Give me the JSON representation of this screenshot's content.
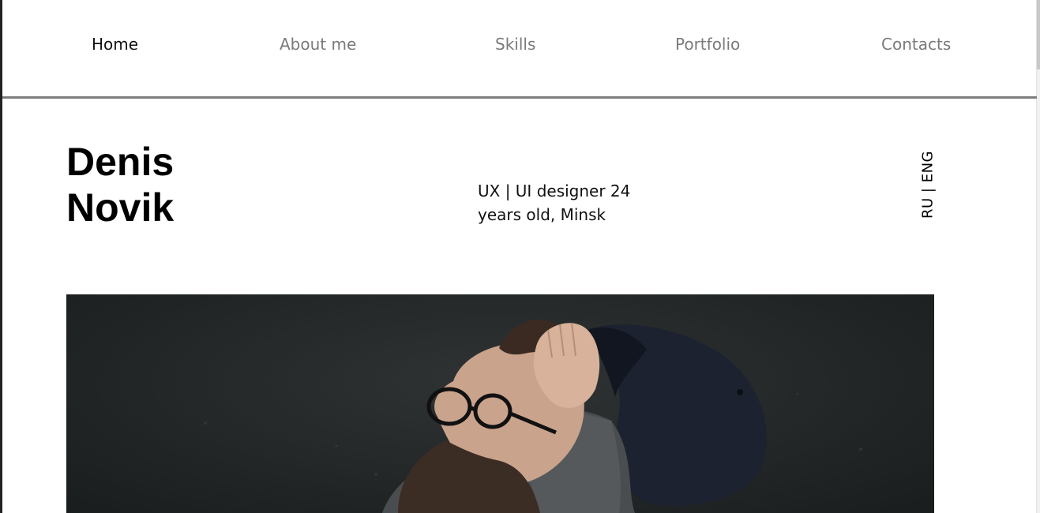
{
  "nav": {
    "items": [
      {
        "label": "Home",
        "active": true
      },
      {
        "label": "About me",
        "active": false
      },
      {
        "label": "Skills",
        "active": false
      },
      {
        "label": "Portfolio",
        "active": false
      },
      {
        "label": "Contacts",
        "active": false
      }
    ]
  },
  "hero": {
    "name_first": "Denis",
    "name_last": "Novik",
    "tagline_line1": "UX | UI designer 24",
    "tagline_line2": "years old, Minsk",
    "language_switch": "RU | ENG"
  },
  "photo": {
    "subject": "man-with-glasses-holding-cap-icon"
  },
  "colors": {
    "nav_active": "#111111",
    "nav_inactive": "#7a7a7a",
    "divider": "#7d7d7d",
    "photo_background": "#232727"
  }
}
